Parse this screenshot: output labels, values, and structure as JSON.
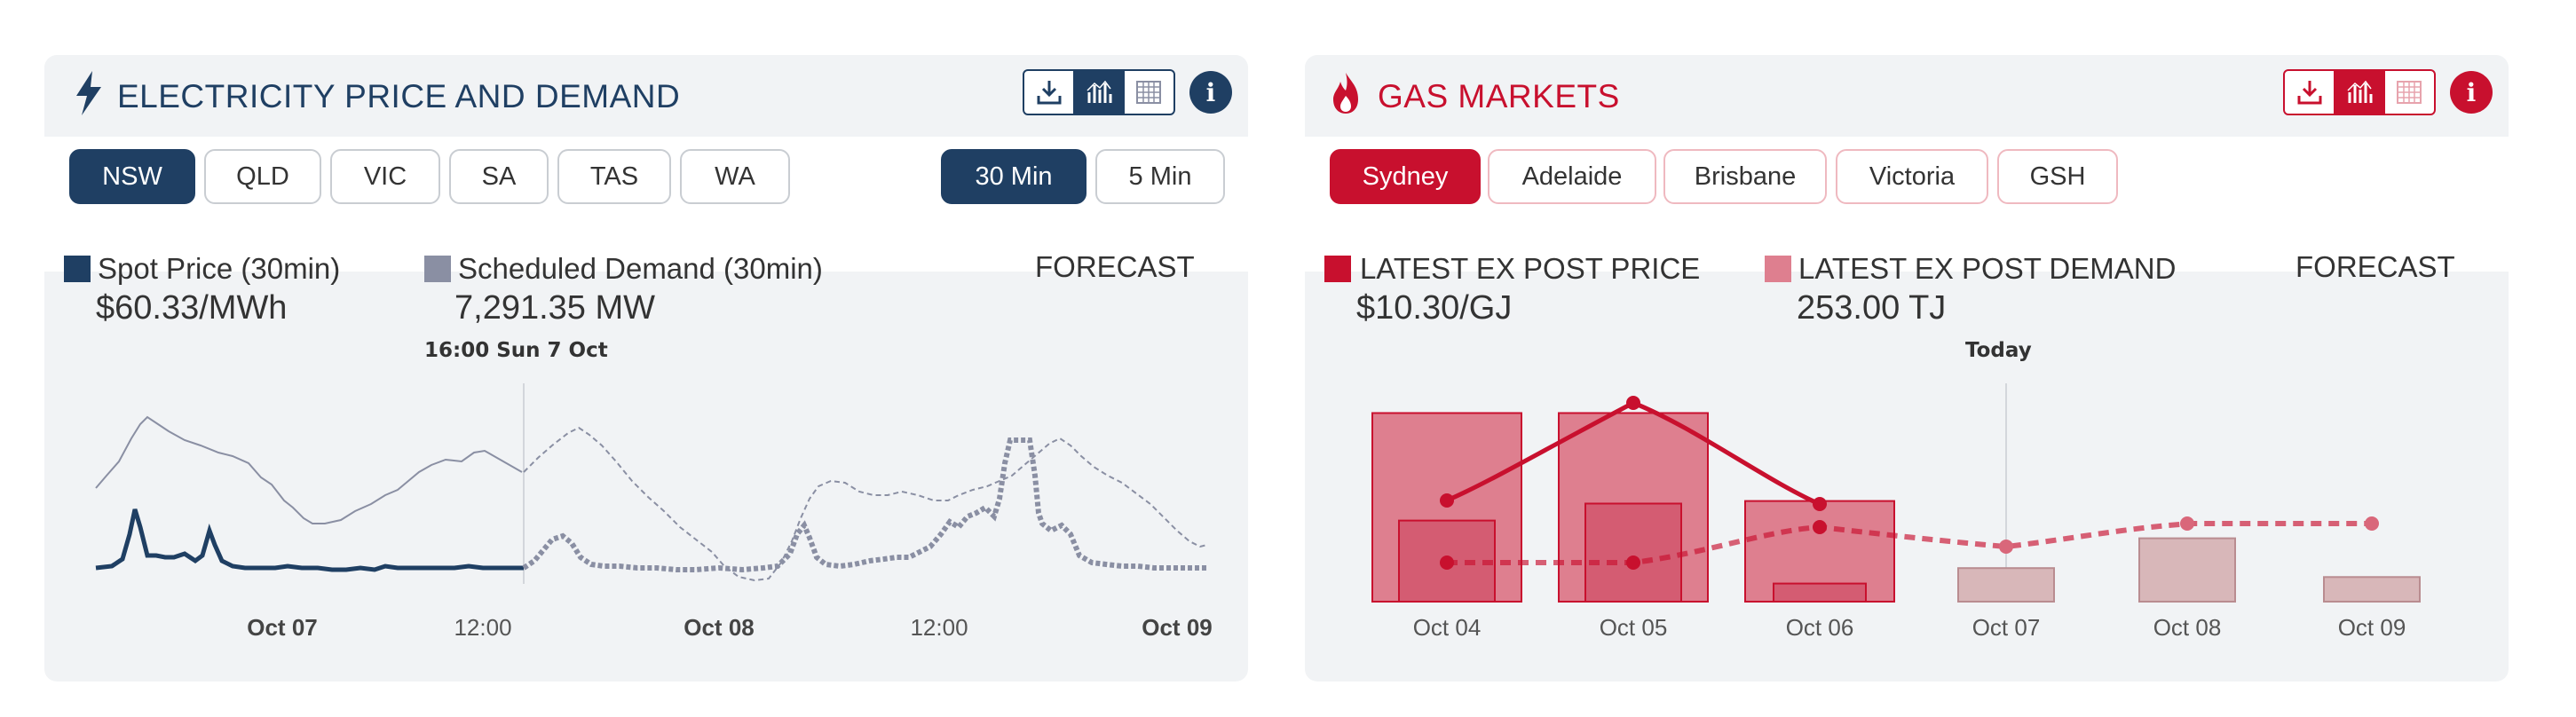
{
  "electricity": {
    "title": "ELECTRICITY PRICE AND DEMAND",
    "regions": [
      "NSW",
      "QLD",
      "VIC",
      "SA",
      "TAS",
      "WA"
    ],
    "selected_region": "NSW",
    "intervals": [
      "30 Min",
      "5 Min"
    ],
    "selected_interval": "30 Min",
    "legend": {
      "price_label": "Spot Price (30min)",
      "price_value": "$60.33/MWh",
      "demand_label": "Scheduled Demand (30min)",
      "demand_value": "7,291.35 MW"
    },
    "forecast_label": "FORECAST",
    "marker_label": "16:00 Sun 7 Oct",
    "colors": {
      "accent": "#1f3f63",
      "demand": "#8a8fa3"
    }
  },
  "gas": {
    "title": "GAS MARKETS",
    "hubs": [
      "Sydney",
      "Adelaide",
      "Brisbane",
      "Victoria",
      "GSH"
    ],
    "selected_hub": "Sydney",
    "legend": {
      "price_label": "LATEST EX POST PRICE",
      "price_value": "$10.30/GJ",
      "demand_label": "LATEST EX POST DEMAND",
      "demand_value": "253.00 TJ"
    },
    "forecast_label": "FORECAST",
    "marker_label": "Today",
    "colors": {
      "accent": "#c8102e",
      "bar": "#de7f8f",
      "forecast_bar": "#d8b7b9"
    }
  },
  "chart_data": [
    {
      "type": "line",
      "x": [
        "Oct 07",
        "12:00",
        "Oct 08",
        "12:00",
        "Oct 09"
      ],
      "series": [
        {
          "name": "Spot Price (30min)",
          "actual": true
        },
        {
          "name": "Scheduled Demand (30min)",
          "actual": true
        }
      ],
      "xlabel": "",
      "ylabel": ""
    },
    {
      "type": "bar",
      "categories": [
        "Oct 04",
        "Oct 05",
        "Oct 06",
        "Oct 07",
        "Oct 08",
        "Oct 09"
      ],
      "series": [
        {
          "name": "LATEST EX POST DEMAND",
          "values": [
            253,
            253,
            135,
            45,
            85,
            33
          ]
        },
        {
          "name": "LATEST EX POST PRICE",
          "values": [
            10.6,
            12.2,
            10.4,
            9.8,
            10.2,
            10.2
          ]
        }
      ],
      "xlabel": "",
      "ylabel": ""
    }
  ]
}
